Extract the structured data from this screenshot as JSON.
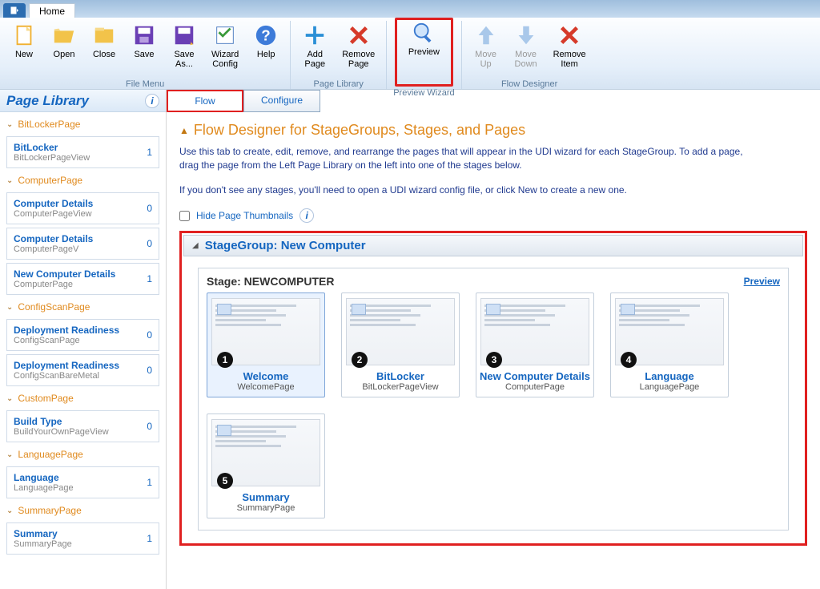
{
  "app": {
    "home_tab": "Home"
  },
  "ribbon": {
    "file_menu": {
      "label": "File Menu",
      "new": "New",
      "open": "Open",
      "close": "Close",
      "save": "Save",
      "save_as": "Save\nAs...",
      "wizard_config": "Wizard\nConfig",
      "help": "Help"
    },
    "page_library": {
      "label": "Page Library",
      "add": "Add\nPage",
      "remove": "Remove\nPage"
    },
    "preview_wizard": {
      "label": "Preview Wizard",
      "preview": "Preview"
    },
    "flow_designer": {
      "label": "Flow Designer",
      "move_up": "Move\nUp",
      "move_down": "Move\nDown",
      "remove_item": "Remove\nItem"
    }
  },
  "sidebar": {
    "title": "Page Library",
    "categories": [
      {
        "name": "BitLockerPage",
        "items": [
          {
            "title": "BitLocker",
            "sub": "BitLockerPageView",
            "count": "1"
          }
        ]
      },
      {
        "name": "ComputerPage",
        "items": [
          {
            "title": "Computer Details",
            "sub": "ComputerPageView",
            "count": "0"
          },
          {
            "title": "Computer Details",
            "sub": "ComputerPageV",
            "count": "0"
          },
          {
            "title": "New Computer Details",
            "sub": "ComputerPage",
            "count": "1"
          }
        ]
      },
      {
        "name": "ConfigScanPage",
        "items": [
          {
            "title": "Deployment Readiness",
            "sub": "ConfigScanPage",
            "count": "0"
          },
          {
            "title": "Deployment Readiness",
            "sub": "ConfigScanBareMetal",
            "count": "0"
          }
        ]
      },
      {
        "name": "CustomPage",
        "items": [
          {
            "title": "Build Type",
            "sub": "BuildYourOwnPageView",
            "count": "0"
          }
        ]
      },
      {
        "name": "LanguagePage",
        "items": [
          {
            "title": "Language",
            "sub": "LanguagePage",
            "count": "1"
          }
        ]
      },
      {
        "name": "SummaryPage",
        "items": [
          {
            "title": "Summary",
            "sub": "SummaryPage",
            "count": "1"
          }
        ]
      }
    ]
  },
  "tabs": {
    "flow": "Flow",
    "configure": "Configure"
  },
  "flow": {
    "title": "Flow Designer for StageGroups, Stages, and Pages",
    "desc1": "Use this tab to create, edit, remove, and rearrange the pages that will appear in the UDI wizard for each StageGroup. To add a page, drag the page from the Left Page Library on the left into one of the stages below.",
    "desc2": "If you don't see any stages, you'll need to open a UDI wizard config file, or click New to create a new one.",
    "hide_thumbs": "Hide Page Thumbnails"
  },
  "stagegroup": {
    "label": "StageGroup: New Computer",
    "stage": {
      "label": "Stage: NEWCOMPUTER",
      "preview": "Preview",
      "pages": [
        {
          "n": "1",
          "title": "Welcome",
          "sub": "WelcomePage"
        },
        {
          "n": "2",
          "title": "BitLocker",
          "sub": "BitLockerPageView"
        },
        {
          "n": "3",
          "title": "New Computer Details",
          "sub": "ComputerPage"
        },
        {
          "n": "4",
          "title": "Language",
          "sub": "LanguagePage"
        },
        {
          "n": "5",
          "title": "Summary",
          "sub": "SummaryPage"
        }
      ]
    }
  }
}
